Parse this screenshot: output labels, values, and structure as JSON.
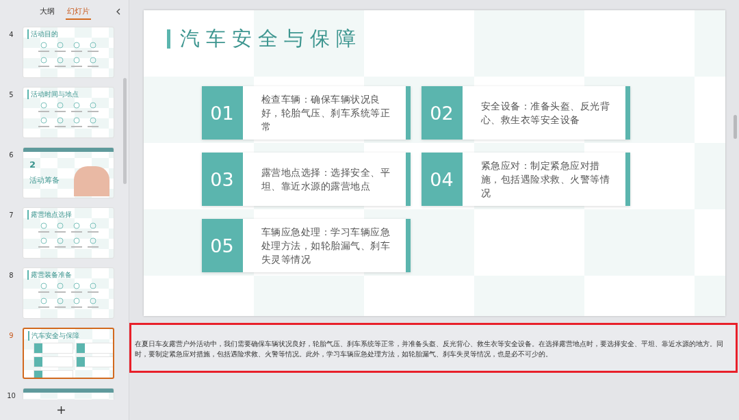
{
  "panel_tabs": [
    {
      "label": "大纲",
      "selected": false
    },
    {
      "label": "幻灯片",
      "selected": true
    }
  ],
  "thumbnails": [
    {
      "number": "4",
      "title": "活动目的",
      "kind": "content",
      "selected": false
    },
    {
      "number": "5",
      "title": "活动时间与地点",
      "kind": "content",
      "selected": false
    },
    {
      "number": "6",
      "title": "活动筹备",
      "section": "2",
      "kind": "section",
      "selected": false
    },
    {
      "number": "7",
      "title": "露营地点选择",
      "kind": "content",
      "selected": false
    },
    {
      "number": "8",
      "title": "露营装备准备",
      "kind": "content",
      "selected": false
    },
    {
      "number": "9",
      "title": "汽车安全与保障",
      "kind": "cards",
      "selected": true
    },
    {
      "number": "10",
      "kind": "section",
      "selected": false
    }
  ],
  "slide": {
    "title": "汽车安全与保障",
    "cards": [
      {
        "number": "01",
        "text": "检查车辆：确保车辆状况良好，轮胎气压、刹车系统等正常"
      },
      {
        "number": "02",
        "text": "安全设备：准备头盔、反光背心、救生衣等安全设备"
      },
      {
        "number": "03",
        "text": "露营地点选择：选择安全、平坦、靠近水源的露营地点"
      },
      {
        "number": "04",
        "text": "紧急应对：制定紧急应对措施，包括遇险求救、火警等情况"
      },
      {
        "number": "05",
        "text": "车辆应急处理：学习车辆应急处理方法，如轮胎漏气、刹车失灵等情况"
      }
    ]
  },
  "notes": "在夏日车友露营户外活动中，我们需要确保车辆状况良好，轮胎气压、刹车系统等正常，并准备头盔、反光背心、救生衣等安全设备。在选择露营地点时，要选择安全、平坦、靠近水源的地方。同时，要制定紧急应对措施，包括遇险求救、火警等情况。此外，学习车辆应急处理方法，如轮胎漏气、刹车失灵等情况，也是必不可少的。"
}
